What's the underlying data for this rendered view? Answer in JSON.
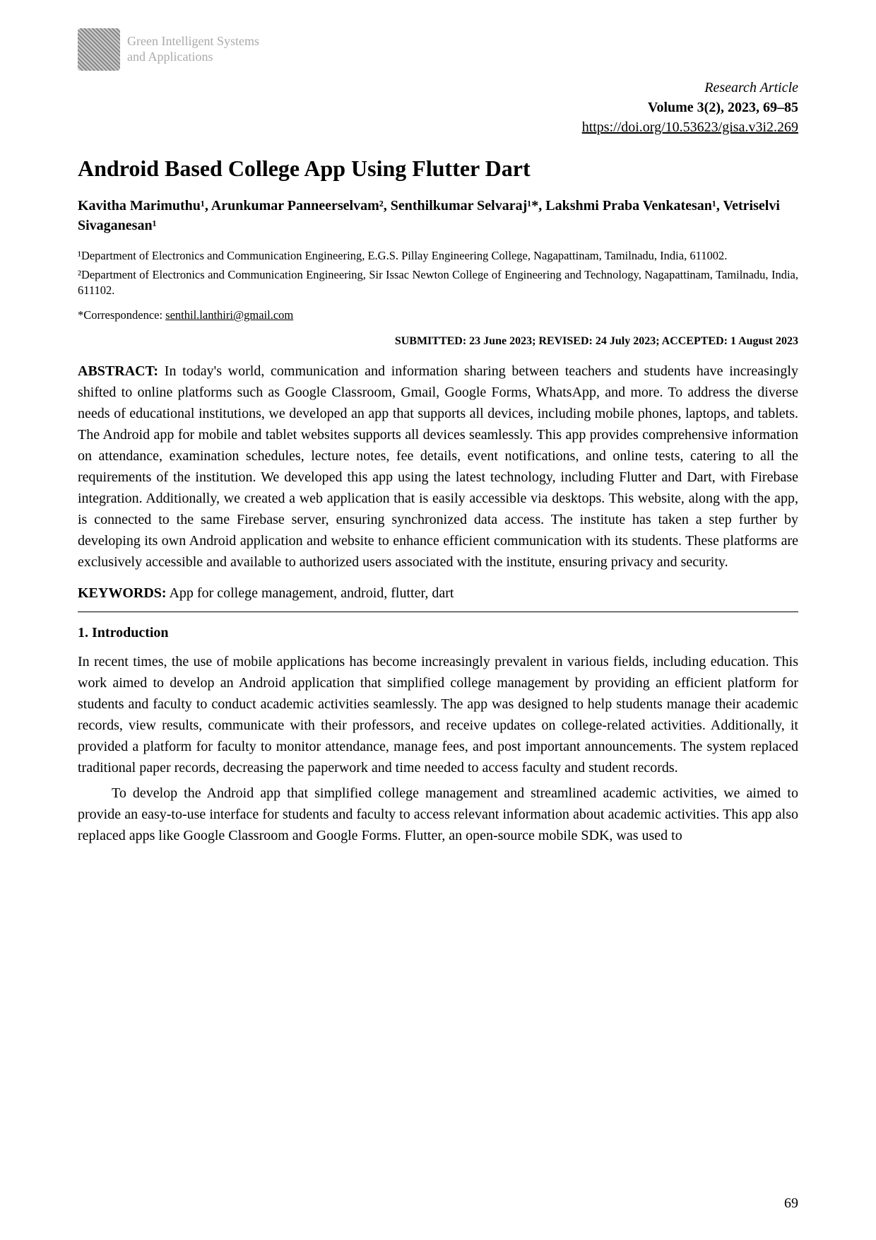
{
  "journal": {
    "name_line1": "Green Intelligent Systems",
    "name_line2": "and Applications"
  },
  "header": {
    "article_type": "Research Article",
    "volume": "Volume 3(2), 2023, 69–85",
    "doi": "https://doi.org/10.53623/gisa.v3i2.269"
  },
  "title": "Android Based College App Using Flutter Dart",
  "authors": "Kavitha Marimuthu¹, Arunkumar Panneerselvam², Senthilkumar Selvaraj¹*, Lakshmi Praba Venkatesan¹, Vetriselvi Sivaganesan¹",
  "affiliations": {
    "a1": "¹Department of Electronics and Communication Engineering, E.G.S. Pillay Engineering College, Nagapattinam, Tamilnadu, India, 611002.",
    "a2": "²Department of Electronics and Communication Engineering, Sir Issac Newton College of Engineering and Technology, Nagapattinam, Tamilnadu, India, 611102."
  },
  "correspondence": {
    "label": "*Correspondence: ",
    "email": "senthil.lanthiri@gmail.com"
  },
  "dates": "SUBMITTED: 23 June 2023; REVISED: 24 July 2023; ACCEPTED: 1 August 2023",
  "abstract": {
    "label": "ABSTRACT:",
    "text": " In today's world, communication and information sharing between teachers and students have increasingly shifted to online platforms such as Google Classroom, Gmail, Google Forms, WhatsApp, and more. To address the diverse needs of educational institutions, we developed an app that supports all devices, including mobile phones, laptops, and tablets. The Android app for mobile and tablet websites supports all devices seamlessly. This app provides comprehensive information on attendance, examination schedules, lecture notes, fee details, event notifications, and online tests, catering to all the requirements of the institution. We developed this app using the latest technology, including Flutter and Dart, with Firebase integration. Additionally, we created a web application that is easily accessible via desktops. This website, along with the app, is connected to the same Firebase server, ensuring synchronized data access. The institute has taken a step further by developing its own Android application and website to enhance efficient communication with its students. These platforms are exclusively accessible and available to authorized users associated with the institute, ensuring privacy and security."
  },
  "keywords": {
    "label": "KEYWORDS:",
    "text": " App for college management, android, flutter, dart"
  },
  "section1": {
    "heading": "1. Introduction",
    "p1": "In recent times, the use of mobile applications has become increasingly prevalent in various fields, including education. This work aimed to develop an Android application that simplified college management by providing an efficient platform for students and faculty to conduct academic activities seamlessly. The app was designed to help students manage their academic records, view results, communicate with their professors, and receive updates on college-related activities. Additionally, it provided a platform for faculty to monitor attendance, manage fees, and post important announcements. The system replaced traditional paper records, decreasing the paperwork and time needed to access faculty and student records.",
    "p2": "To develop the Android app that simplified college management and streamlined academic activities, we aimed to provide an easy-to-use interface for students and faculty to access relevant information about academic activities. This app also replaced apps like Google Classroom and Google Forms. Flutter, an open-source mobile SDK, was used to"
  },
  "page_number": "69"
}
